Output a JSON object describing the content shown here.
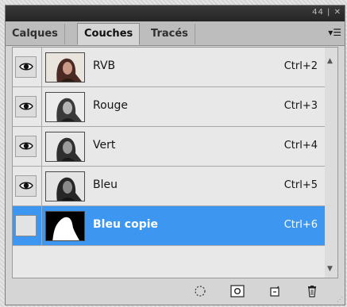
{
  "panel": {
    "title_controls": "44 | ✕",
    "tabs": [
      {
        "label": "Calques",
        "active": false
      },
      {
        "label": "Couches",
        "active": true
      },
      {
        "label": "Tracés",
        "active": false
      }
    ],
    "menu_icon": "panel-menu-icon"
  },
  "channels": [
    {
      "name": "RVB",
      "shortcut": "Ctrl+2",
      "visible": true,
      "selected": false,
      "thumbnail": "color-portrait"
    },
    {
      "name": "Rouge",
      "shortcut": "Ctrl+3",
      "visible": true,
      "selected": false,
      "thumbnail": "grayscale-portrait"
    },
    {
      "name": "Vert",
      "shortcut": "Ctrl+4",
      "visible": true,
      "selected": false,
      "thumbnail": "grayscale-portrait"
    },
    {
      "name": "Bleu",
      "shortcut": "Ctrl+5",
      "visible": true,
      "selected": false,
      "thumbnail": "grayscale-portrait"
    },
    {
      "name": "Bleu copie",
      "shortcut": "Ctrl+6",
      "visible": false,
      "selected": true,
      "thumbnail": "mask-silhouette"
    }
  ],
  "footer_buttons": [
    {
      "icon": "load-selection-icon"
    },
    {
      "icon": "save-selection-icon"
    },
    {
      "icon": "new-channel-icon"
    },
    {
      "icon": "delete-channel-icon"
    }
  ],
  "colors": {
    "selection": "#3d97f0",
    "titlebar": "#2a2a2a",
    "panel_bg": "#d5d5d5"
  }
}
